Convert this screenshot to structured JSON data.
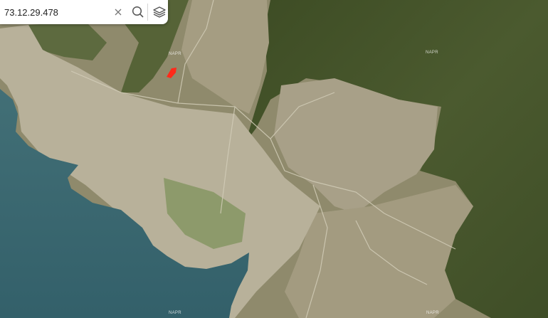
{
  "search": {
    "value": "73.12.29.478"
  },
  "icons": {
    "clear": "close-icon",
    "search": "search-icon",
    "layers": "layers-icon"
  },
  "map": {
    "type": "satellite",
    "watermark": "NAPR",
    "colors": {
      "water": "#3d6b72",
      "forest": "#46552b",
      "field": "#a39a80",
      "parcel_highlight": "#ff2a1a"
    }
  }
}
